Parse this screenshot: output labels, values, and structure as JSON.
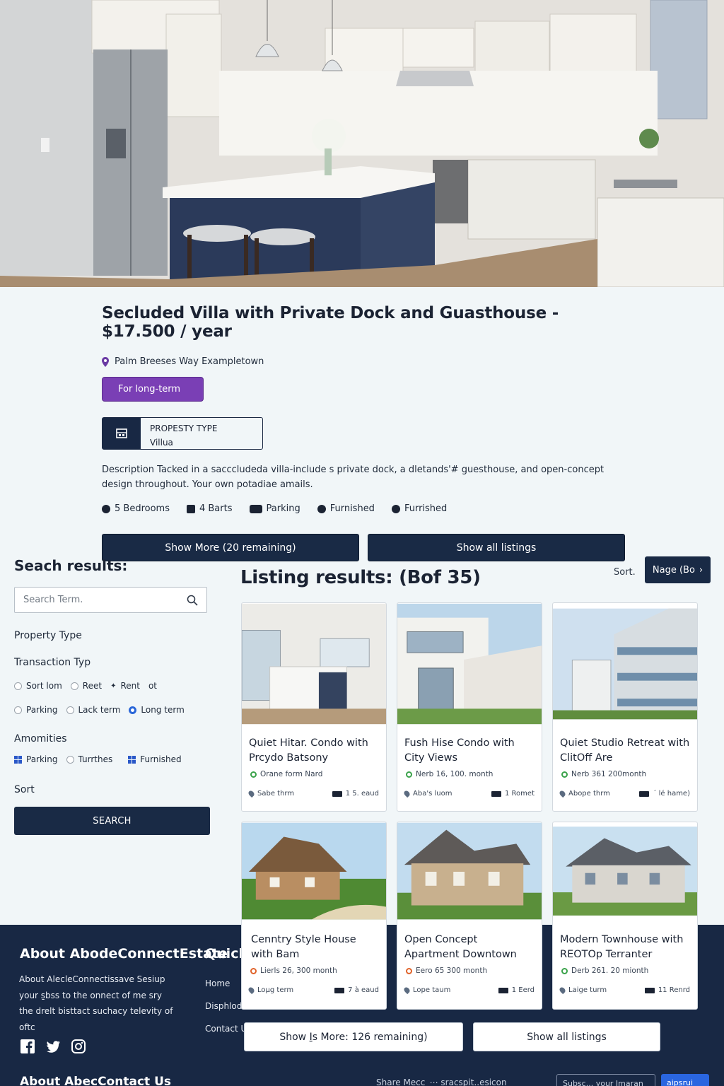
{
  "listing": {
    "title": "Secluded Villa with Private Dock and Guasthouse - $17.500 / year",
    "address": "Palm Breeses Way  Exampletown",
    "badge": "For long-term",
    "property_type_label": "PROPESTY TYPE",
    "property_type_value": "Villua",
    "description": "Description  Tacked in a sacccludeda villa-include s private dock, a dletands'# guesthouse, and open-concept design throughout. Your own potadiae amails.",
    "features": [
      "5 Bedrooms",
      "4 Barts",
      "Parking",
      "Furnished",
      "Furrished"
    ],
    "show_more": "Show More (20 remaining)",
    "show_all": "Show all listings"
  },
  "sidebar": {
    "heading": "Seach results:",
    "search_placeholder": "Search Term.",
    "property_type": "Property Type",
    "transaction_type": "Transaction Typ",
    "radios_row1": [
      "Sort lom",
      "Reet",
      "Rent",
      "ot"
    ],
    "radios_row2": [
      "Parking",
      "Lack term",
      "Long term"
    ],
    "amenities": "Amomities",
    "amenity_items": [
      "Parking",
      "Turrthes",
      "Furnished"
    ],
    "sort": "Sort",
    "search_button": "SEARCH"
  },
  "results": {
    "heading": "Listing results:  (Bof 35)",
    "sort_label": "Sort.",
    "page_button": "Nage (Bo"
  },
  "cards": [
    {
      "title": "Quiet Hitar. Condo with Prcydo Batsony",
      "price": "Orane form    Nard",
      "loc": "Sabe thrm",
      "beds": "1 5. eaud",
      "dot": "#3aa24a"
    },
    {
      "title": "Fush Hise Condo with City Views",
      "price": "Nerb   16, 100. month",
      "loc": "Aba's luom",
      "beds": "1  Romet",
      "dot": "#3aa24a"
    },
    {
      "title": "Quiet Studio Retreat with ClitOff Are",
      "price": "Nerb   361  200month",
      "loc": "Abope thrm",
      "beds": "´ lé hame)",
      "dot": "#3aa24a"
    },
    {
      "title": "Cenntry Style House with Bam",
      "price": "Lierls   26, 300 month",
      "loc": "Loµg term",
      "beds": "7 à eaud",
      "dot": "#e0632a"
    },
    {
      "title": "Open Concept Apartment Downtown",
      "price": "Eero   65 300 month",
      "loc": "Lope taum",
      "beds": "1  Eerd",
      "dot": "#e0632a"
    },
    {
      "title": "Modern Townhouse with REOTOp Terranter",
      "price": "Derb   261. 20 mionth",
      "loc": "Laige turm",
      "beds": "11   Renrd",
      "dot": "#3aa24a"
    }
  ],
  "bottom_buttons": {
    "show_more": "Show I̱s More: 126 remaining)",
    "show_all": "Show all listings"
  },
  "footer": {
    "about_title": "About AbodeConnectEstate",
    "about_text": "About AlecleConnectissave Sesiup your s̱bss to the onnect of me sry the drelt bisttact suchacy televity of oftc",
    "quick_title": "Quick",
    "links": [
      "Home",
      "Disphlod",
      "Contact U"
    ],
    "about_contact": "About AbecContact Us",
    "share": "Share Mecc   ⋯  sracspit..esicon",
    "newsletter_placeholder": "Subsc... your Imaran",
    "subscribe": "aipsrui"
  }
}
